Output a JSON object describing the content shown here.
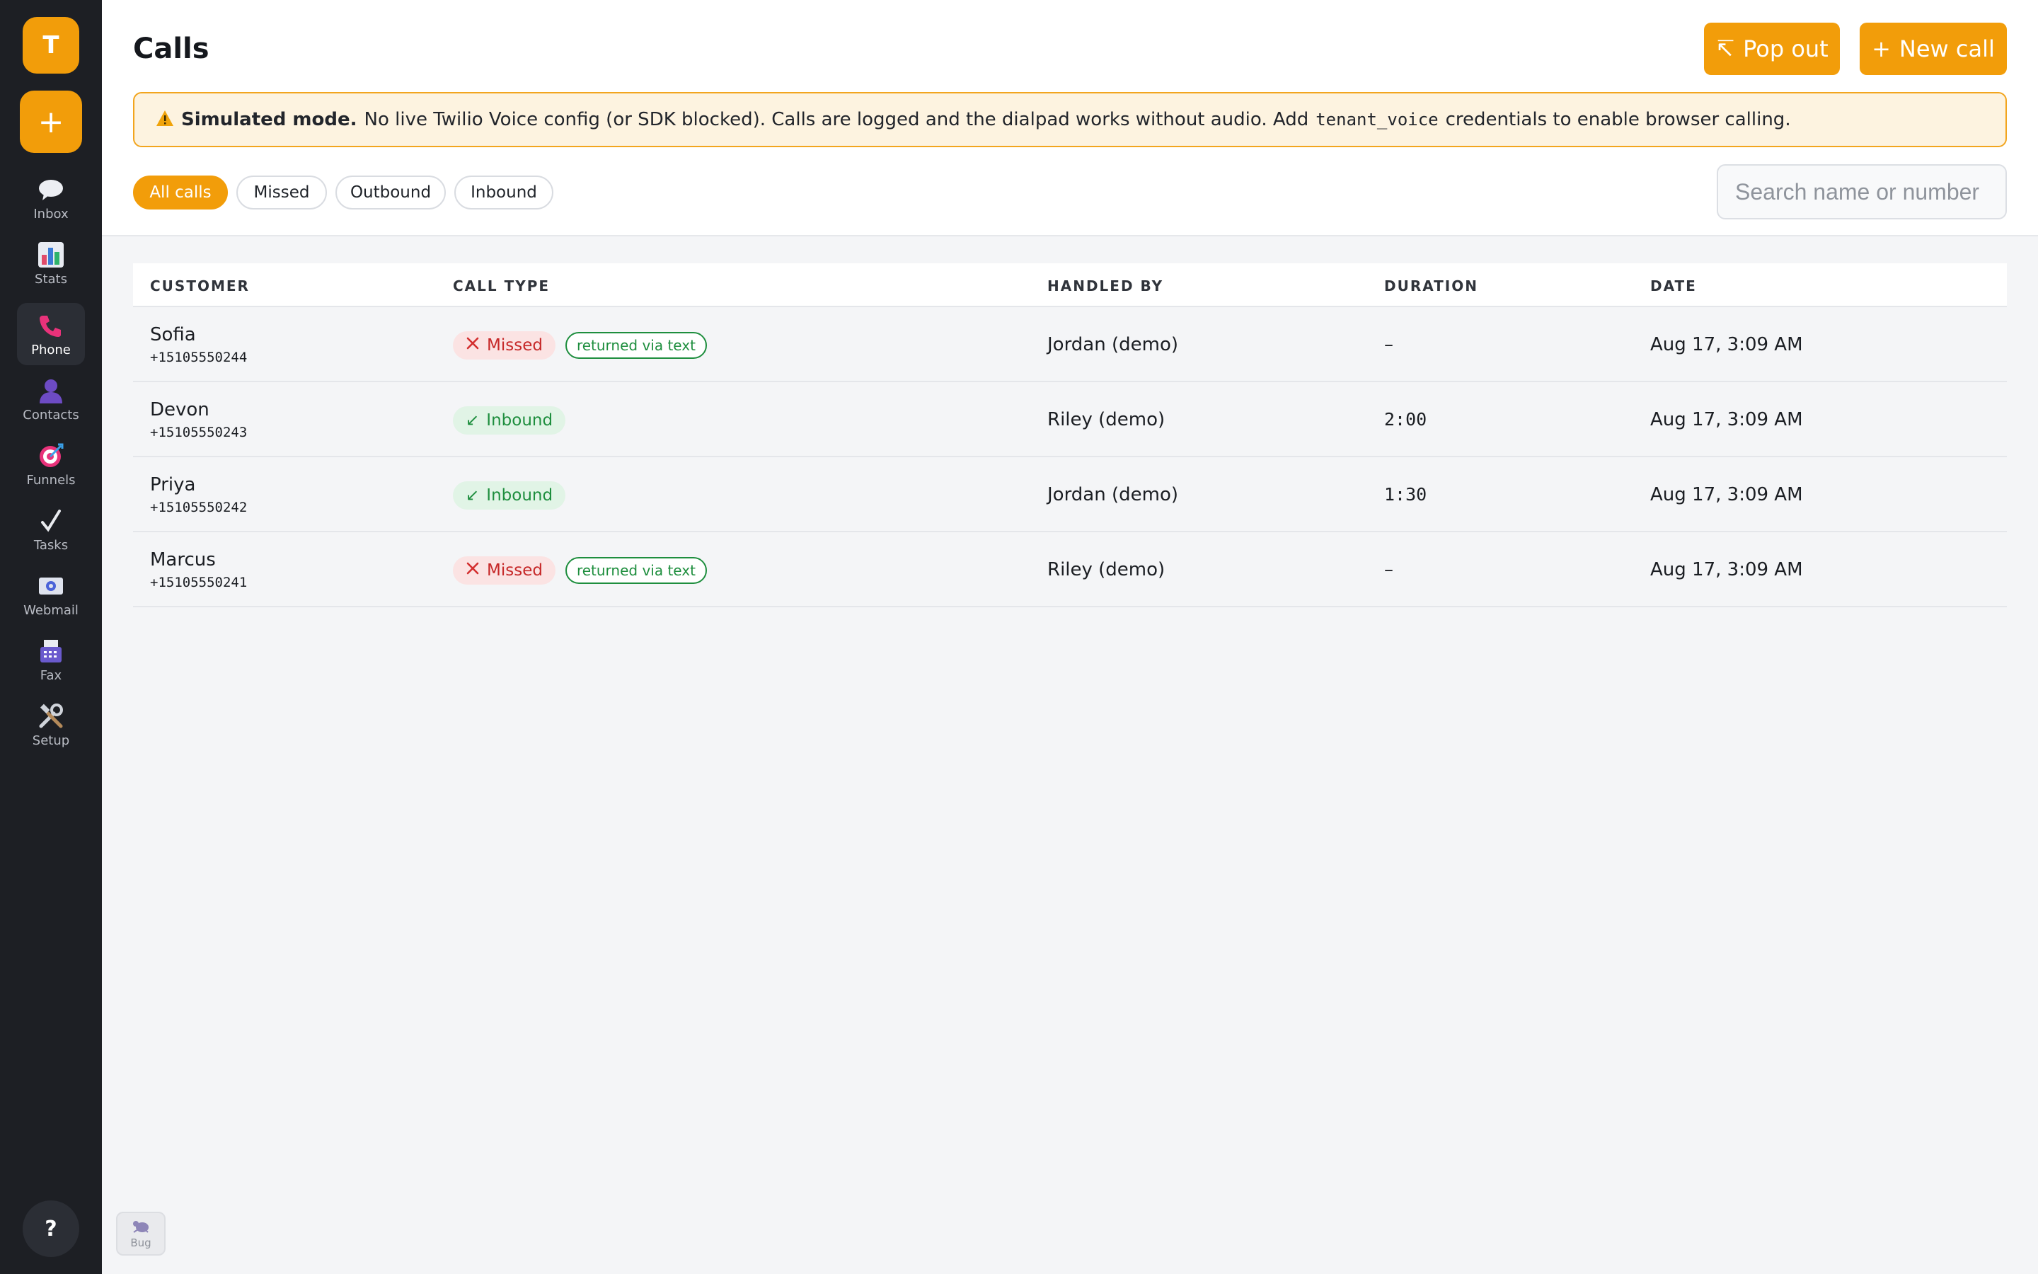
{
  "sidebar": {
    "avatar_letter": "T",
    "add_icon": "+",
    "items": [
      {
        "label": "Inbox",
        "icon": "chat-bubble-icon"
      },
      {
        "label": "Stats",
        "icon": "bar-chart-icon"
      },
      {
        "label": "Phone",
        "icon": "phone-icon",
        "active": true
      },
      {
        "label": "Contacts",
        "icon": "person-icon"
      },
      {
        "label": "Funnels",
        "icon": "target-icon"
      },
      {
        "label": "Tasks",
        "icon": "checkmark-icon"
      },
      {
        "label": "Webmail",
        "icon": "mail-icon"
      },
      {
        "label": "Fax",
        "icon": "fax-icon"
      },
      {
        "label": "Setup",
        "icon": "tools-icon"
      }
    ],
    "help_label": "?"
  },
  "header": {
    "title": "Calls",
    "popout_label": "Pop out",
    "popout_icon": "↸",
    "newcall_label": "New call",
    "newcall_icon": "+"
  },
  "banner": {
    "strong": "Simulated mode.",
    "text1": "No live Twilio Voice config (or SDK blocked). Calls are logged and the dialpad works without audio. Add",
    "code": "tenant_voice",
    "text2": "credentials to enable browser calling."
  },
  "filters": [
    "All calls",
    "Missed",
    "Outbound",
    "Inbound"
  ],
  "search": {
    "placeholder": "Search name or number"
  },
  "table": {
    "headers": [
      "CUSTOMER",
      "CALL TYPE",
      "HANDLED BY",
      "DURATION",
      "DATE"
    ],
    "rows": [
      {
        "name": "Sofia",
        "phone": "+15105550244",
        "type": "Missed",
        "tag": "returned via text",
        "handled_by": "Jordan (demo)",
        "duration": "–",
        "date": "Aug 17, 3:09 AM"
      },
      {
        "name": "Devon",
        "phone": "+15105550243",
        "type": "Inbound",
        "tag": "",
        "handled_by": "Riley (demo)",
        "duration": "2:00",
        "date": "Aug 17, 3:09 AM"
      },
      {
        "name": "Priya",
        "phone": "+15105550242",
        "type": "Inbound",
        "tag": "",
        "handled_by": "Jordan (demo)",
        "duration": "1:30",
        "date": "Aug 17, 3:09 AM"
      },
      {
        "name": "Marcus",
        "phone": "+15105550241",
        "type": "Missed",
        "tag": "returned via text",
        "handled_by": "Riley (demo)",
        "duration": "–",
        "date": "Aug 17, 3:09 AM"
      }
    ]
  },
  "bug": {
    "label": "Bug"
  },
  "colors": {
    "accent": "#f29d0a",
    "missed": "#c62828",
    "inbound": "#1e8e3e"
  }
}
